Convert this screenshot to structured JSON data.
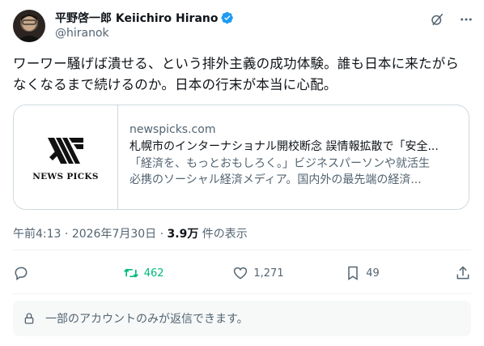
{
  "author": {
    "name": "平野啓一郎 Keiichiro Hirano",
    "handle": "@hiranok"
  },
  "post": {
    "text_line1": "ワーワー騒げば潰せる、という排外主義の成功体験。誰も日本に来たがら",
    "text_line2": "なくなるまで続けるのか。日本の行末が本当に心配。"
  },
  "card": {
    "thumb_logo": "NEWS PICKS",
    "domain": "newspicks.com",
    "title": "札幌市のインターナショナル開校断念 誤情報拡散で「安全...",
    "desc_line1": "「経済を、もっとおもしろく。」ビジネスパーソンや就活生",
    "desc_line2": "必携のソーシャル経済メディア。国内外の最先端の経済..."
  },
  "meta": {
    "time": "午前4:13",
    "date": "2026年7月30日",
    "views": "3.9万",
    "views_suffix": "件の表示"
  },
  "actions": {
    "retweets": "462",
    "likes": "1,271",
    "bookmarks": "49"
  },
  "reply_notice": "一部のアカウントのみが返信できます。",
  "colors": {
    "accent": "#1d9bf0",
    "retweet": "#00ba7c",
    "secondary_text": "#536471"
  }
}
